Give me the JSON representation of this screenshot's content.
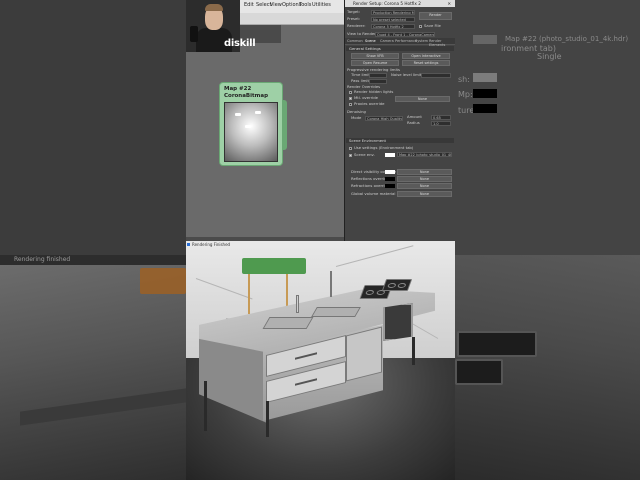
{
  "background": {
    "status_text": "Rendering finished",
    "right_panel_text": "ironment tab)",
    "right_panel_map": "Map #22 (photo_studio_01_4k.hdr)",
    "right_panel_chip": "Single",
    "right_row_labels": [
      "sh:",
      "Mp:",
      "ture:"
    ],
    "swatch_colors": [
      "#7c7c7c",
      "#000000",
      "#000000"
    ]
  },
  "webcam": {
    "label": ""
  },
  "brand": {
    "text": "diskill"
  },
  "editor": {
    "menu_items": [
      "Edit",
      "Select",
      "View",
      "Options",
      "Tools",
      "Utilities"
    ],
    "node": {
      "title_line1": "Map #22",
      "title_line2": "CoronaBitmap"
    }
  },
  "render_dialog": {
    "title": "Render Setup: Corona 5 Hotfix 2",
    "target_label": "Target:",
    "target_value": "Production Rendering Mode",
    "preset_label": "Preset:",
    "preset_value": "No preset selected",
    "renderer_label": "Renderer:",
    "renderer_value": "Corona 5 Hotfix 2",
    "save_file_label": "Save File",
    "render_button": "Render",
    "view_label": "View to Render:",
    "view_value": "Quad 4 - Front 1 - CoronaCamera",
    "tabs": [
      "Common",
      "Scene",
      "Camera",
      "Performance",
      "System",
      "Render Elements"
    ],
    "active_tab": "Scene",
    "general_settings": "General Settings",
    "buttons": [
      "Show VFB",
      "Open Interactive",
      "Open Resume",
      "Reset settings"
    ],
    "progressive_label": "Progressive rendering limits",
    "time_limit_label": "Time limit",
    "noise_label": "Noise level limit:",
    "passes_label": "Pass limit",
    "denoise_label": "Denoising",
    "mode_label": "Mode",
    "mode_value": "Corona High Quality",
    "amount_label": "Amount",
    "amount_value": "0,65",
    "radius_label": "Radius",
    "radius_value": "1,0",
    "render_override": "Render Overrides",
    "render_hidden": "Render hidden lights",
    "material_override": "Mtl. override",
    "none_label": "None",
    "proxies_label": "Proxies override",
    "scene_env_label": "Scene Environment",
    "direct_vis_label": "Direct visibility override",
    "reflections_label": "Reflections override",
    "refractions_label": "Refractions override",
    "single_map": "Map #22 (photo_studio_01_4k.hdr)",
    "use_env_label": "Use settings (Environment tab)",
    "scene_env": "Scene env.",
    "swatch_colors": [
      "#ffffff",
      "#000000",
      "#000000",
      "#000000"
    ],
    "global_volume": "Global volume material"
  },
  "vfb": {
    "title": "Rendering Finished"
  }
}
